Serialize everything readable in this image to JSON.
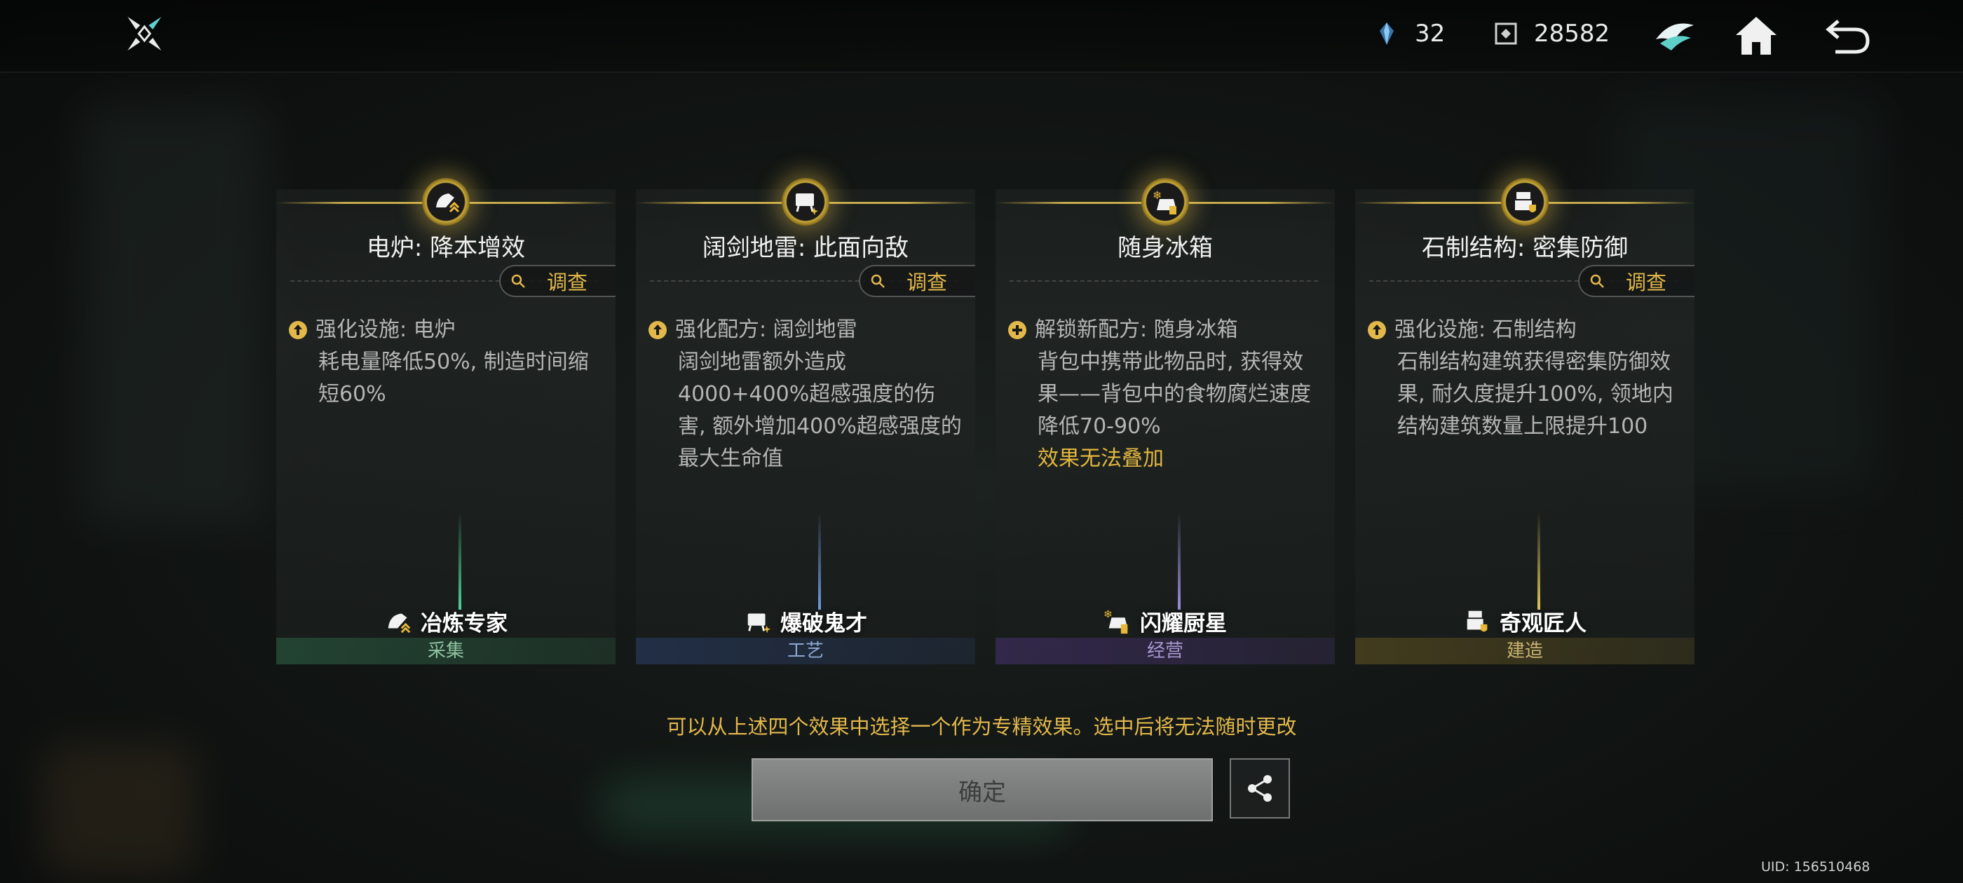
{
  "header": {
    "resources": [
      {
        "icon": "crystal-icon",
        "value": "32"
      },
      {
        "icon": "token-icon",
        "value": "28582"
      }
    ],
    "buttons": {
      "emblem": "emblem-icon",
      "home": "home-icon",
      "back": "back-icon"
    }
  },
  "cards": [
    {
      "title": "电炉: 降本增效",
      "investigate_label": "调查",
      "bullet_icon": "upgrade-icon",
      "head": "强化设施: 电炉",
      "body": "耗电量降低50%, 制造时间缩短60%",
      "warn": "",
      "specialist": "冶炼专家",
      "category": "采集",
      "accent": "#2e6a4a",
      "cat_color": "#8fc3a0",
      "beam": "#4fd39a"
    },
    {
      "title": "阔剑地雷: 此面向敌",
      "investigate_label": "调查",
      "bullet_icon": "upgrade-icon",
      "head": "强化配方: 阔剑地雷",
      "body": "阔剑地雷额外造成4000+400%超感强度的伤害, 额外增加400%超感强度的最大生命值",
      "warn": "",
      "specialist": "爆破鬼才",
      "category": "工艺",
      "accent": "#2a3e6a",
      "cat_color": "#8fa6d0",
      "beam": "#6f9be0"
    },
    {
      "title": "随身冰箱",
      "investigate_label": "",
      "bullet_icon": "unlock-icon",
      "head": "解锁新配方: 随身冰箱",
      "body": "背包中携带此物品时, 获得效果——背包中的食物腐烂速度降低70-90%",
      "warn": "效果无法叠加",
      "specialist": "闪耀厨星",
      "category": "经营",
      "accent": "#43306a",
      "cat_color": "#a89ad2",
      "beam": "#9c8fe0"
    },
    {
      "title": "石制结构: 密集防御",
      "investigate_label": "调查",
      "bullet_icon": "upgrade-icon",
      "head": "强化设施: 石制结构",
      "body": "石制结构建筑获得密集防御效果, 耐久度提升100%, 领地内结构建筑数量上限提升100",
      "warn": "",
      "specialist": "奇观匠人",
      "category": "建造",
      "accent": "#5e5020",
      "cat_color": "#c9b370",
      "beam": "#e0c65a"
    }
  ],
  "notice": "可以从上述四个效果中选择一个作为专精效果。选中后将无法随时更改",
  "confirm_label": "确定",
  "uid": "UID: 156510468"
}
